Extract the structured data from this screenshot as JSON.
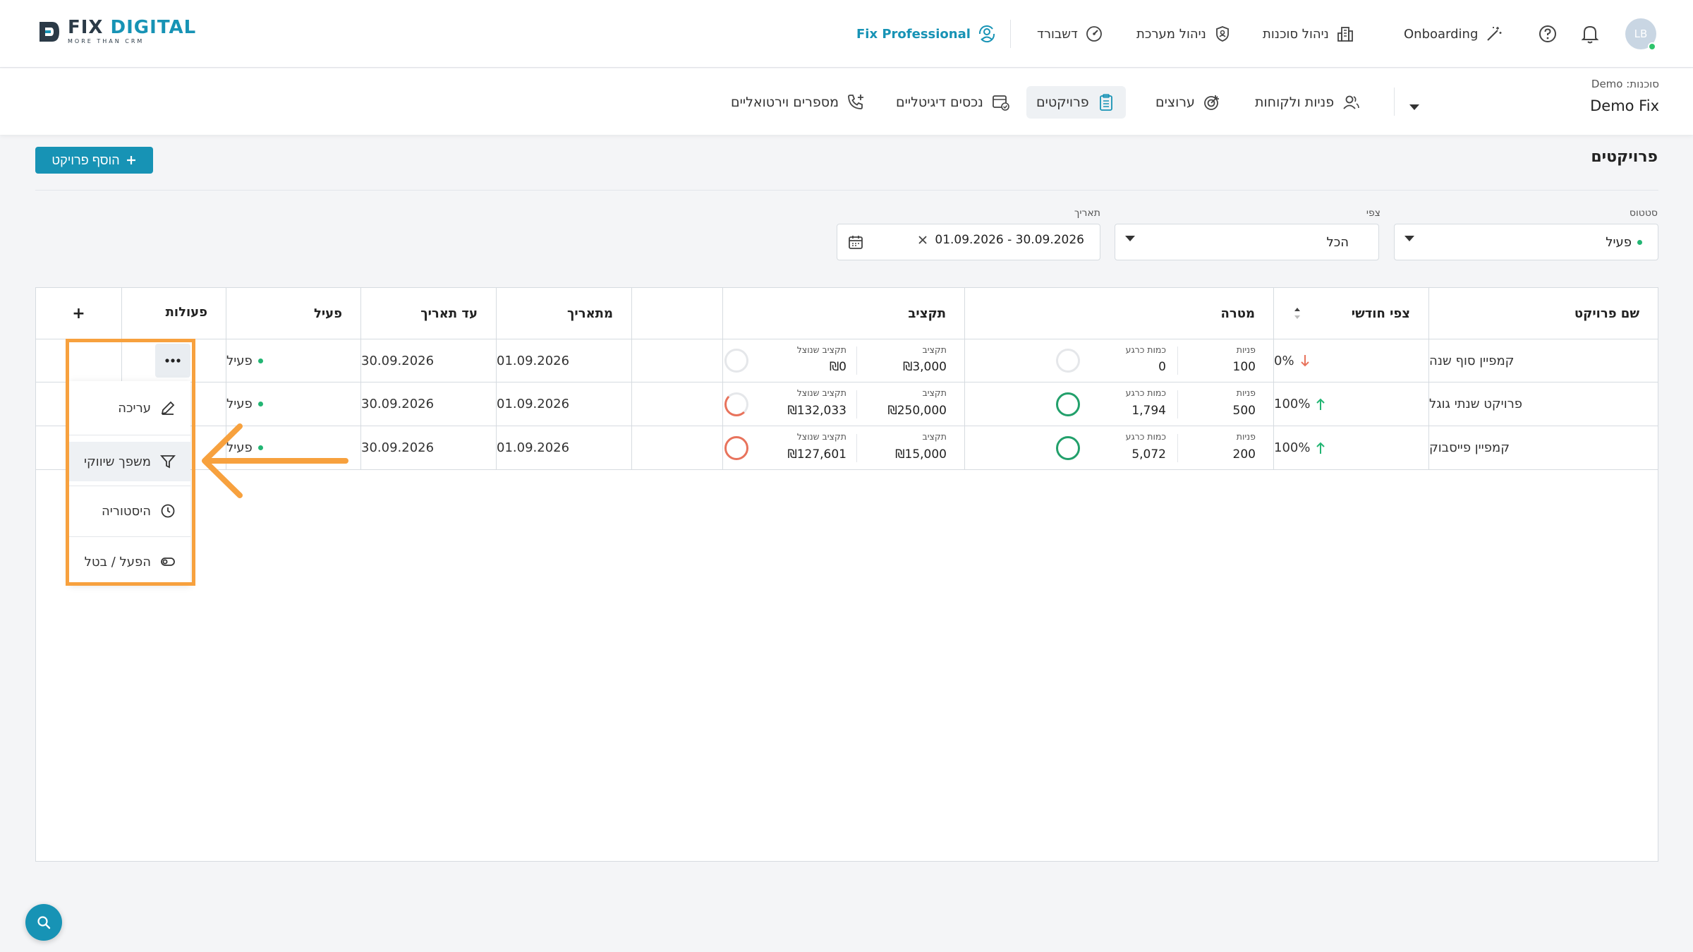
{
  "brand": {
    "name_a": "FIX",
    "name_b": "DIGITAL",
    "tagline": "MORE THAN CRM"
  },
  "topnav": {
    "fix_professional": "Fix Professional",
    "dashboard": "דשבורד",
    "system_mgmt": "ניהול מערכת",
    "agency_mgmt": "ניהול סוכנות",
    "onboarding": "Onboarding",
    "avatar_initials": "LB"
  },
  "agency": {
    "label": "סוכנות: Demo",
    "value": "Demo Fix"
  },
  "subnav": {
    "leads": "פניות ולקוחות",
    "channels": "ערוצים",
    "projects": "פרויקטים",
    "digital_assets": "נכסים דיגיטליים",
    "virtual_numbers": "מספרים וירטואליים"
  },
  "page": {
    "title": "פרויקטים",
    "add_button": "הוסף פרויקט"
  },
  "filters": {
    "status_label": "סטטוס",
    "status_value": "פעיל",
    "forecast_label": "צפי",
    "forecast_value": "הכל",
    "date_label": "תאריך",
    "date_value": "01.09.2026 - 30.09.2026"
  },
  "table": {
    "headers": {
      "name": "שם פרויקט",
      "forecast": "צפי חודשי",
      "goal": "מטרה",
      "budget": "תקציב",
      "from": "מתאריך",
      "to": "עד תאריך",
      "active": "פעיל",
      "actions": "פעולות",
      "add": "+"
    },
    "sublabels": {
      "leads": "פניות",
      "current": "כמות כרגע",
      "budget": "תקציב",
      "used": "תקציב שנוצל"
    },
    "rows": [
      {
        "name": "קמפיין סוף שנה",
        "forecast": "0%",
        "trend": "down",
        "leads": "100",
        "current": "0",
        "budget": "₪3,000",
        "used": "₪0",
        "from": "01.09.2026",
        "to": "30.09.2026",
        "status": "פעיל"
      },
      {
        "name": "פרויקט שנתי גוגל",
        "forecast": "100%",
        "trend": "up",
        "leads": "500",
        "current": "1,794",
        "budget": "₪250,000",
        "used": "₪132,033",
        "from": "01.09.2026",
        "to": "30.09.2026",
        "status": "פעיל"
      },
      {
        "name": "קמפיין פייסבוק",
        "forecast": "100%",
        "trend": "up",
        "leads": "200",
        "current": "5,072",
        "budget": "₪15,000",
        "used": "₪127,601",
        "from": "01.09.2026",
        "to": "30.09.2026",
        "status": "פעיל"
      }
    ]
  },
  "menu": {
    "edit": "עריכה",
    "funnel": "משפך שיווקי",
    "history": "היסטוריה",
    "toggle": "הפעל / בטל"
  },
  "colors": {
    "accent": "#1793b5",
    "green": "#22b573",
    "red": "#e8735c",
    "highlight": "#f7a13e"
  }
}
